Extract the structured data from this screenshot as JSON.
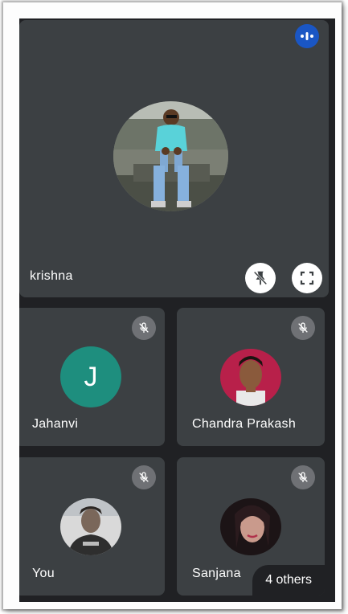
{
  "main_tile": {
    "name": "krishna",
    "pin_button_icon": "pin-off-icon",
    "fullscreen_button_icon": "fullscreen-icon",
    "speaking_indicator_icon": "audio-bars-icon"
  },
  "tiles": [
    {
      "name": "Jahanvi",
      "avatar_letter": "J",
      "avatar_color": "#1e8e7e",
      "muted": true
    },
    {
      "name": "Chandra Prakash",
      "muted": true
    },
    {
      "name": "You",
      "muted": true
    },
    {
      "name": "Sanjana",
      "muted": true
    }
  ],
  "others_chip": {
    "label": "4 others"
  },
  "colors": {
    "background": "#202124",
    "tile": "#3c4043",
    "speaking_badge": "#1a56c4",
    "mute_badge": "#6f7175"
  }
}
